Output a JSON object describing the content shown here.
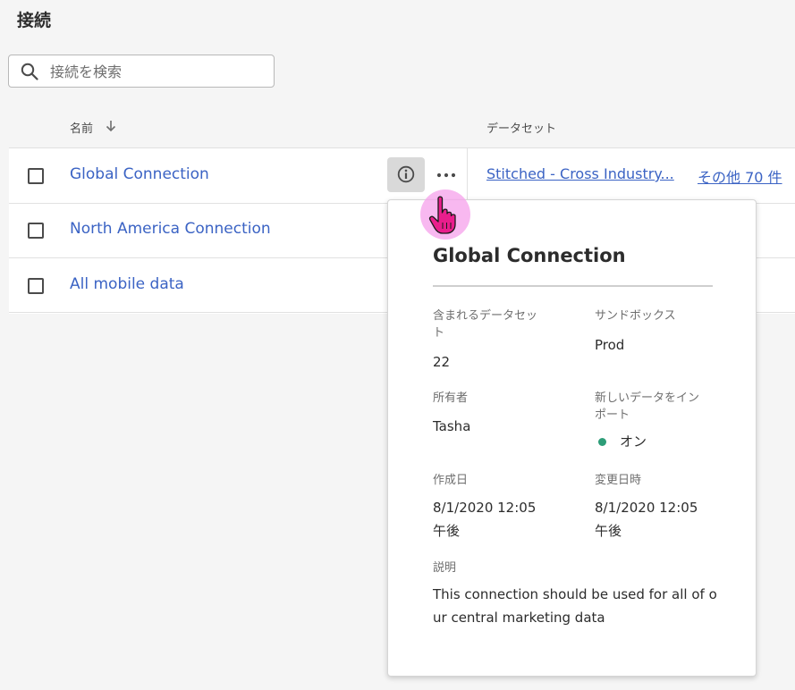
{
  "page": {
    "title": "接続"
  },
  "search": {
    "placeholder": "接続を検索",
    "value": ""
  },
  "table": {
    "columns": {
      "name": "名前",
      "dataset": "データセット"
    },
    "rows": [
      {
        "name": "Global Connection",
        "dataset": "Stitched - Cross Industry...",
        "more": "その他 70 件"
      },
      {
        "name": "North America Connection"
      },
      {
        "name": "All mobile data"
      }
    ]
  },
  "icons": {
    "search": "search-icon",
    "sort": "arrow-down-icon",
    "info": "info-icon",
    "more": "more-horizontal-icon",
    "cursor": "hand-pointer-icon"
  },
  "popover": {
    "title": "Global Connection",
    "datasets_label": "含まれるデータセット",
    "datasets_value": "22",
    "sandbox_label": "サンドボックス",
    "sandbox_value": "Prod",
    "owner_label": "所有者",
    "owner_value": "Tasha",
    "import_label": "新しいデータをインポート",
    "import_value": "オン",
    "created_label": "作成日",
    "created_value": "8/1/2020 12:05午後",
    "modified_label": "変更日時",
    "modified_value": "8/1/2020 12:05午後",
    "description_label": "説明",
    "description_value": "This connection should be used for all of our central marketing data"
  },
  "colors": {
    "link": "#3b63c4",
    "status_on": "#2d9d78",
    "cursor_halo": "#f5a0eb",
    "cursor": "#e91e8c"
  }
}
